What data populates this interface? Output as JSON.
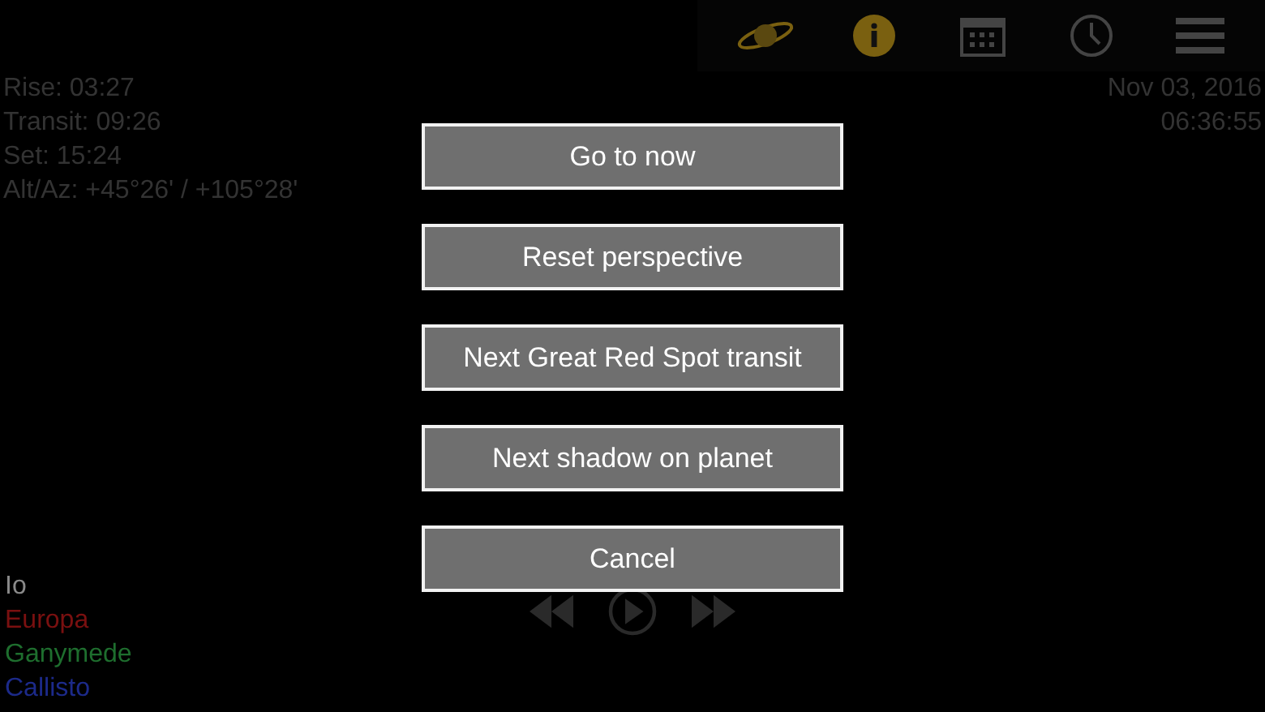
{
  "toolbar": [
    {
      "kind": "planet"
    },
    {
      "kind": "info"
    },
    {
      "kind": "calendar"
    },
    {
      "kind": "clock"
    },
    {
      "kind": "menu"
    }
  ],
  "ephemeris": [
    "Rise: 03:27",
    "Transit: 09:26",
    "Set: 15:24",
    "Alt/Az: +45°26' / +105°28'"
  ],
  "date": "Nov 03, 2016",
  "time": "06:36:55",
  "moons": [
    {
      "name": "Io",
      "color": "#8a8a8a"
    },
    {
      "name": "Europa",
      "color": "#7a1010"
    },
    {
      "name": "Ganymede",
      "color": "#1e6e2e"
    },
    {
      "name": "Callisto",
      "color": "#1c2a8a"
    }
  ],
  "playback": [
    {
      "kind": "rewind"
    },
    {
      "kind": "play"
    },
    {
      "kind": "forward"
    }
  ],
  "dialog": {
    "buttons": [
      "Go to now",
      "Reset perspective",
      "Next Great Red Spot transit",
      "Next shadow on planet",
      "Cancel"
    ]
  }
}
